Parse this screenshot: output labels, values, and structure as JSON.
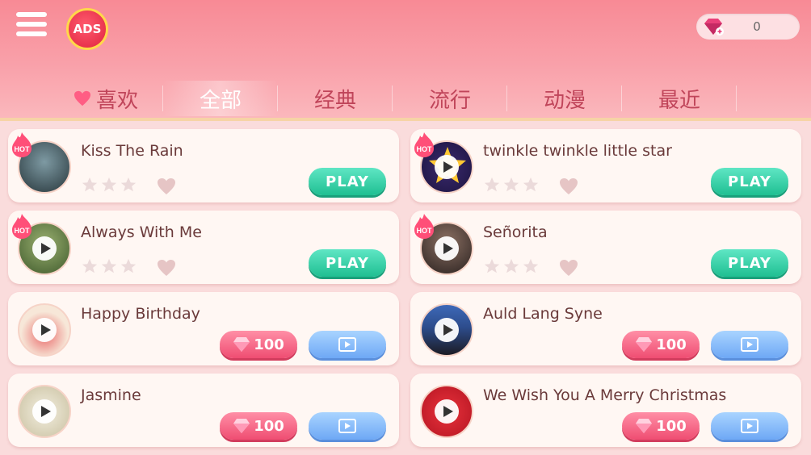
{
  "header": {
    "ads_label": "ADS",
    "gem_count": "0"
  },
  "tabs": [
    {
      "label": "喜欢",
      "icon": "heart-icon"
    },
    {
      "label": "全部",
      "active": true
    },
    {
      "label": "经典"
    },
    {
      "label": "流行"
    },
    {
      "label": "动漫"
    },
    {
      "label": "最近"
    }
  ],
  "colors": {
    "header_pink": "#f88a95",
    "play_green": "#1fbf92",
    "gem_pink": "#ef4d72",
    "video_blue": "#6ea8f5",
    "title_text": "#6a3a3a"
  },
  "songs": [
    {
      "title": "Kiss The Rain",
      "hot": true,
      "hot_label": "HOT",
      "stars": 0,
      "action": "play",
      "action_label": "PLAY"
    },
    {
      "title": "twinkle twinkle little star",
      "hot": true,
      "hot_label": "HOT",
      "stars": 0,
      "action": "play",
      "action_label": "PLAY"
    },
    {
      "title": "Always With Me",
      "hot": true,
      "hot_label": "HOT",
      "stars": 0,
      "action": "play",
      "action_label": "PLAY"
    },
    {
      "title": "Señorita",
      "hot": true,
      "hot_label": "HOT",
      "stars": 0,
      "action": "play",
      "action_label": "PLAY"
    },
    {
      "title": "Happy Birthday",
      "hot": false,
      "action": "unlock",
      "price": "100"
    },
    {
      "title": "Auld Lang Syne",
      "hot": false,
      "action": "unlock",
      "price": "100"
    },
    {
      "title": "Jasmine",
      "hot": false,
      "action": "unlock",
      "price": "100"
    },
    {
      "title": "We Wish You A Merry Christmas",
      "hot": false,
      "action": "unlock",
      "price": "100"
    }
  ]
}
